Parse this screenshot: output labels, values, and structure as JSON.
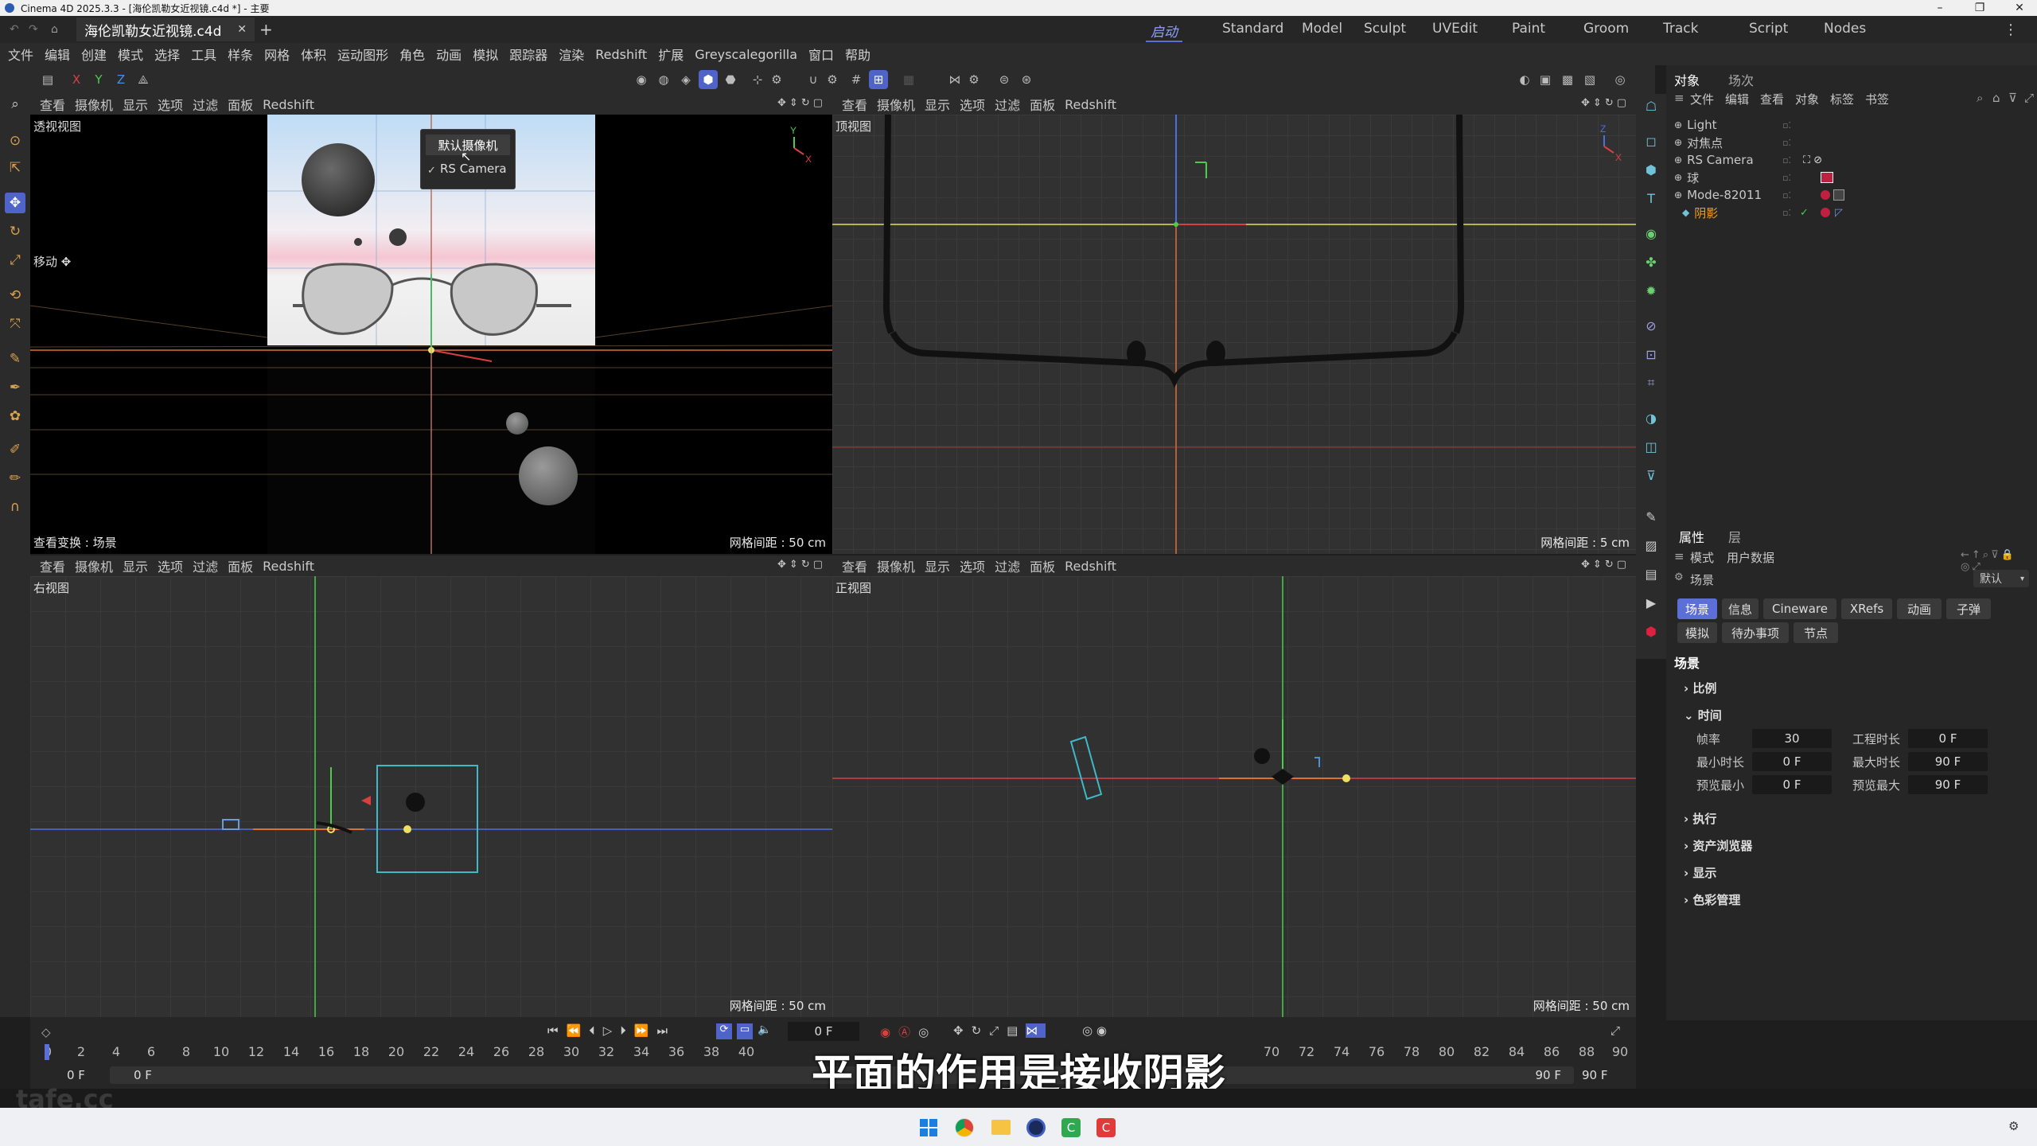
{
  "window": {
    "title": "Cinema 4D 2025.3.3 - [海伦凯勒女近视镜.c4d *] - 主要"
  },
  "tabs": {
    "doc_tab": "海伦凯勒女近视镜.c4d",
    "layouts": [
      "启动",
      "Standard",
      "Model",
      "Sculpt",
      "UVEdit",
      "Paint",
      "Groom",
      "Track",
      "Script",
      "Nodes"
    ]
  },
  "menu": [
    "文件",
    "编辑",
    "创建",
    "模式",
    "选择",
    "工具",
    "样条",
    "网格",
    "体积",
    "运动图形",
    "角色",
    "动画",
    "模拟",
    "跟踪器",
    "渲染",
    "Redshift",
    "扩展",
    "Greyscalegorilla",
    "窗口",
    "帮助"
  ],
  "viewport_menu": [
    "查看",
    "摄像机",
    "显示",
    "选项",
    "过滤",
    "面板",
    "Redshift"
  ],
  "axis": {
    "x": "X",
    "y": "Y",
    "z": "Z"
  },
  "viewports": {
    "perspective": {
      "name": "透视视图",
      "grid": "网格间距 : 50 cm",
      "status": "查看变换 : 场景",
      "move_label": "移动 ✥"
    },
    "top": {
      "name": "顶视图",
      "grid": "网格间距 : 5 cm"
    },
    "right": {
      "name": "右视图",
      "grid": "网格间距 : 50 cm"
    },
    "front": {
      "name": "正视图",
      "grid": "网格间距 : 50 cm"
    }
  },
  "camera_menu": {
    "default": "默认摄像机",
    "rs_camera": "RS Camera",
    "check": "✓"
  },
  "objects_panel": {
    "tabs": [
      "对象",
      "场次"
    ],
    "menu": [
      "文件",
      "编辑",
      "查看",
      "对象",
      "标签",
      "书签"
    ],
    "items": [
      "Light",
      "对焦点",
      "RS Camera",
      "球",
      "Mode-82011",
      "阴影"
    ]
  },
  "attributes": {
    "tabs": [
      "属性",
      "层"
    ],
    "menu": [
      "模式",
      "用户数据"
    ],
    "scene_label": "场景",
    "preset": "默认",
    "buttons_row1": [
      "场景",
      "信息",
      "Cineware",
      "XRefs",
      "动画",
      "子弹"
    ],
    "buttons_row2": [
      "模拟",
      "待办事项",
      "节点"
    ],
    "header": "场景",
    "sections": [
      "比例",
      "时间",
      "执行",
      "资产浏览器",
      "显示",
      "色彩管理"
    ],
    "time_fields": [
      {
        "label": "帧率",
        "value": "30"
      },
      {
        "label": "工程时长",
        "value": "0 F"
      },
      {
        "label": "最小时长",
        "value": "0 F"
      },
      {
        "label": "最大时长",
        "value": "90 F"
      },
      {
        "label": "预览最小",
        "value": "0 F"
      },
      {
        "label": "预览最大",
        "value": "90 F"
      }
    ]
  },
  "timeline": {
    "current_frame": "0 F",
    "ticks": [
      "0",
      "2",
      "4",
      "6",
      "8",
      "10",
      "12",
      "14",
      "16",
      "18",
      "20",
      "22",
      "24",
      "26",
      "28",
      "30",
      "32",
      "34",
      "36",
      "38",
      "40",
      "70",
      "72",
      "74",
      "76",
      "78",
      "80",
      "82",
      "84",
      "86",
      "88",
      "90"
    ],
    "start_a": "0 F",
    "start_b": "0 F",
    "end_a": "90 F",
    "end_b": "90 F"
  },
  "subtitle": "平面的作用是接收阴影",
  "watermark": "tafe.cc",
  "colors": {
    "accent": "#5b6fd6",
    "active_tab": "#4f63c9",
    "axis_x": "#d84040",
    "axis_y": "#4ccb4c",
    "axis_z": "#4a6fe0"
  }
}
